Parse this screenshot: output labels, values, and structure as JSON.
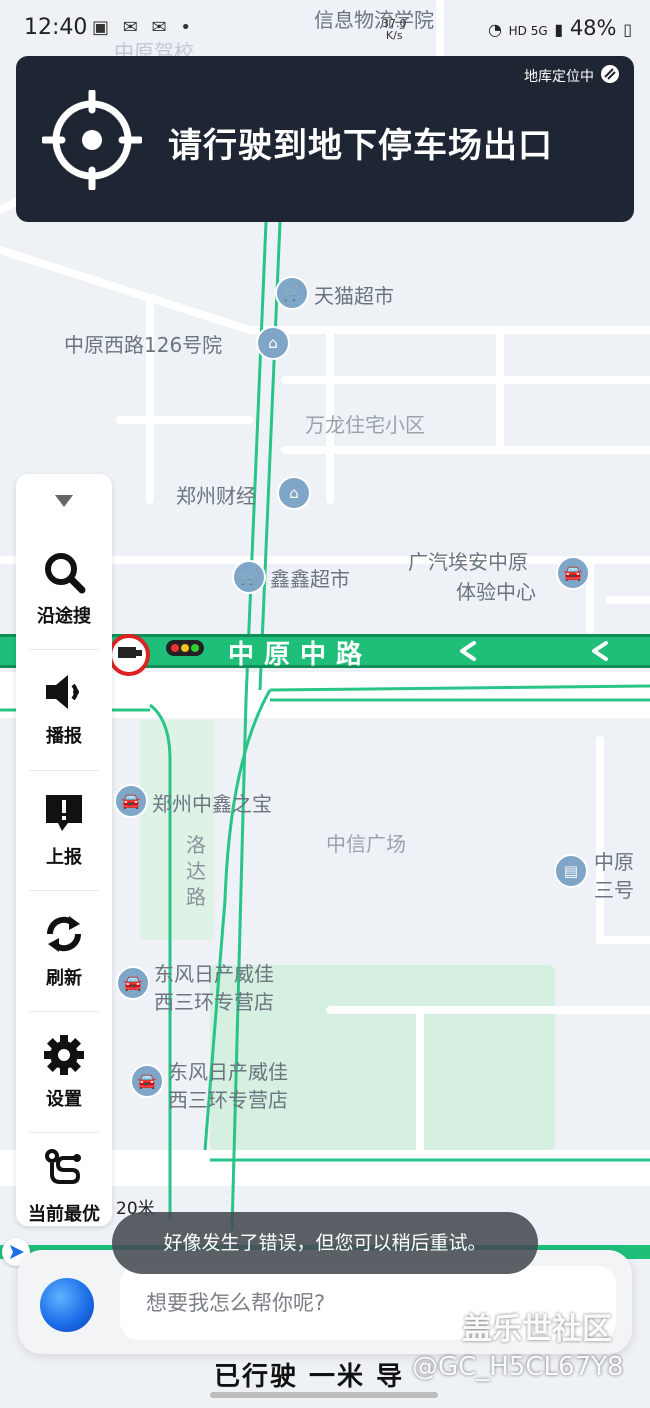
{
  "status_bar": {
    "time": "12:40",
    "speed_value": "37.0",
    "speed_unit": "K/s",
    "network": "HD 5G",
    "battery": "48%"
  },
  "banner": {
    "location_status": "地库定位中",
    "instruction": "请行驶到地下停车场出口"
  },
  "map": {
    "road_name": "中原中路",
    "road_label_vertical": "洛达路",
    "pois": [
      {
        "name": "信息物流学院",
        "icon": "school-icon"
      },
      {
        "name": "中原驾校",
        "icon": "driving-school-icon"
      },
      {
        "name": "天猫超市",
        "icon": "cart-icon"
      },
      {
        "name": "中原西路126号院",
        "icon": "residence-icon"
      },
      {
        "name": "万龙住宅小区",
        "icon": ""
      },
      {
        "name": "郑州财经",
        "icon": "school-icon"
      },
      {
        "name": "鑫鑫超市",
        "icon": "cart-icon"
      },
      {
        "name": "广汽埃安中原",
        "icon": "car-icon"
      },
      {
        "name": "体验中心",
        "icon": ""
      },
      {
        "name": "郑州中鑫之宝",
        "icon": "car-icon"
      },
      {
        "name": "中信广场",
        "icon": ""
      },
      {
        "name": "中原",
        "icon": "building-icon"
      },
      {
        "name": "三号",
        "icon": ""
      },
      {
        "name": "东风日产威佳",
        "icon": "car-icon"
      },
      {
        "name": "西三环专营店",
        "icon": ""
      },
      {
        "name": "东风日产威佳",
        "icon": "car-icon"
      },
      {
        "name": "西三环专营店",
        "icon": ""
      }
    ]
  },
  "sidebar": {
    "items": [
      {
        "label": "沿途搜",
        "icon": "search-icon"
      },
      {
        "label": "播报",
        "icon": "speaker-icon"
      },
      {
        "label": "上报",
        "icon": "report-icon"
      },
      {
        "label": "刷新",
        "icon": "refresh-icon"
      },
      {
        "label": "设置",
        "icon": "gear-icon"
      },
      {
        "label": "当前最优",
        "icon": "route-icon"
      }
    ]
  },
  "scale": "20米",
  "toast": "好像发生了错误，但您可以稍后重试。",
  "assistant": {
    "placeholder": "想要我怎么帮你呢?"
  },
  "watermark": {
    "site": "盖乐世社区",
    "user": "@GC_H5CL67Y8"
  },
  "colors": {
    "route_green": "#1fbf7a",
    "banner_bg": "#1e2533",
    "map_bg": "#eef1f6",
    "park_green": "#d7efe1"
  }
}
